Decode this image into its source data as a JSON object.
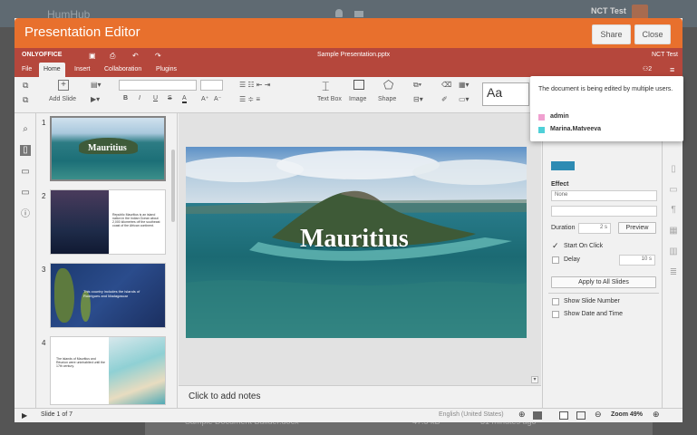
{
  "background": {
    "logo": "HumHub",
    "user_name": "NCT Test",
    "file_row": {
      "name": "Sample Document Builder.docx",
      "size": "47.5 kB",
      "time": "31 minutes ago"
    }
  },
  "modal": {
    "title": "Presentation Editor",
    "share_label": "Share",
    "close_label": "Close"
  },
  "editor": {
    "brand": "ONLYOFFICE",
    "filename": "Sample Presentation.pptx",
    "user": "NCT Test",
    "users_count": "2",
    "menu": [
      "File",
      "Home",
      "Insert",
      "Collaboration",
      "Plugins"
    ],
    "active_menu": "Home",
    "toolbar": {
      "add_slide": "Add Slide",
      "text_box": "Text Box",
      "image": "Image",
      "shape": "Shape"
    }
  },
  "popup": {
    "message": "The document is being edited by multiple users.",
    "users": [
      {
        "name": "admin",
        "color": "#f0a0d0"
      },
      {
        "name": "Marina.Matveeva",
        "color": "#4fd0d8"
      }
    ]
  },
  "slides": [
    {
      "num": "1",
      "title": "Mauritius"
    },
    {
      "num": "2",
      "text": "Republic Mauritius is an island nation in the Indian Ocean about 2,000 kilometres off the southeast coast of the African continent."
    },
    {
      "num": "3",
      "text": "This country includes the islands of Rodrigues and Madagascar"
    },
    {
      "num": "4",
      "text": "The islands of Mauritius and Réunion were uninhabited until the 17th century."
    }
  ],
  "main_slide": {
    "title": "Mauritius"
  },
  "notes_placeholder": "Click to add notes",
  "right_panel": {
    "effect_label": "Effect",
    "effect_value": "None",
    "duration_label": "Duration",
    "duration_value": "2 s",
    "preview_label": "Preview",
    "start_on_click": "Start On Click",
    "delay_label": "Delay",
    "delay_value": "10 s",
    "apply_all": "Apply to All Slides",
    "show_slide_number": "Show Slide Number",
    "show_date_time": "Show Date and Time"
  },
  "status": {
    "slide_info": "Slide 1 of 7",
    "language": "English (United States)",
    "zoom": "Zoom 49%"
  },
  "colors": {
    "modal_header": "#e8702d",
    "editor_header": "#b5473c"
  }
}
